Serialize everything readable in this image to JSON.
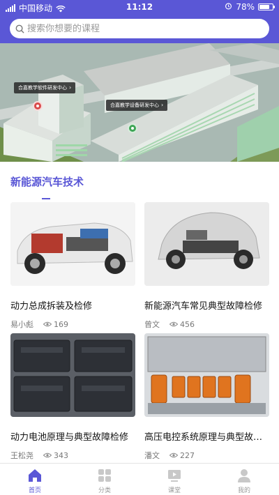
{
  "status_bar": {
    "carrier": "中国移动",
    "time": "11:12",
    "battery": "78%",
    "battery_level": 0.78
  },
  "search": {
    "placeholder": "搜索你想要的课程"
  },
  "banner": {
    "label_left": "合嘉教学软件研发中心",
    "label_right": "合嘉教学设备研发中心"
  },
  "section": {
    "title": "新能源汽车技术"
  },
  "courses": [
    {
      "title": "动力总成拆装及检修",
      "author": "易小彪",
      "views": "169"
    },
    {
      "title": "新能源汽车常见典型故障检修",
      "author": "曾文",
      "views": "456"
    },
    {
      "title": "动力电池原理与典型故障检修",
      "author": "王松尧",
      "views": "343"
    },
    {
      "title": "高压电控系统原理与典型故障检修",
      "author": "潘文",
      "views": "227"
    }
  ],
  "tabbar": {
    "items": [
      {
        "label": "首页",
        "icon": "home-icon",
        "active": true
      },
      {
        "label": "分类",
        "icon": "grid-icon",
        "active": false
      },
      {
        "label": "课堂",
        "icon": "video-icon",
        "active": false
      },
      {
        "label": "我的",
        "icon": "user-icon",
        "active": false
      }
    ]
  },
  "colors": {
    "accent": "#5a57d6",
    "muted_text": "#777777"
  }
}
